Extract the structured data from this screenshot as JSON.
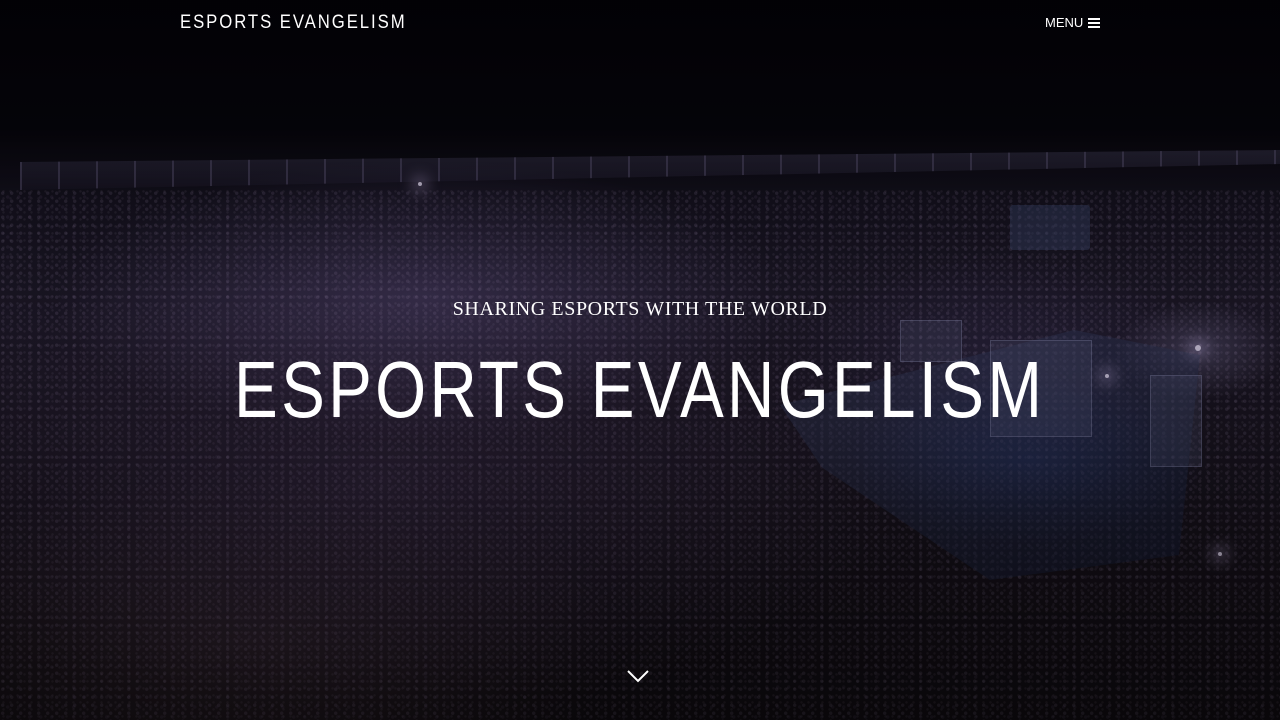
{
  "nav": {
    "brand": "ESPORTS EVANGELISM",
    "menu_label": "MENU",
    "menu_icon": "hamburger-icon"
  },
  "hero": {
    "tagline": "SHARING ESPORTS WITH THE WORLD",
    "title": "ESPORTS EVANGELISM",
    "background": "arena-crowd-photo",
    "scroll_icon": "chevron-down-icon"
  },
  "colors": {
    "text": "#ffffff",
    "background": "#07060c"
  }
}
